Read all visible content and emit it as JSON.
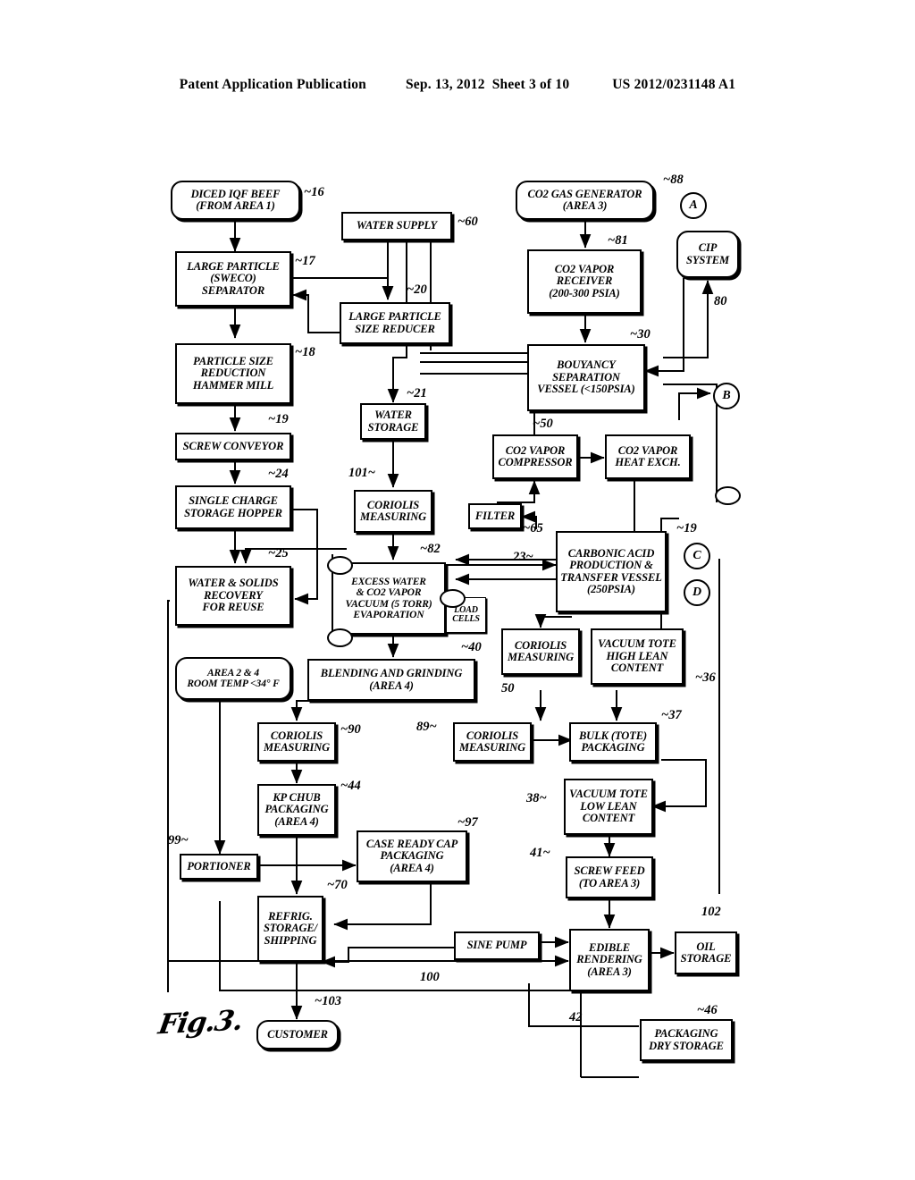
{
  "header": {
    "publication": "Patent Application Publication",
    "date": "Sep. 13, 2012",
    "sheet": "Sheet 3 of 10",
    "docnum": "US 2012/0231148 A1"
  },
  "figure": {
    "label": "Fig.3.",
    "nodes": [
      {
        "id": "n16",
        "ref": "16",
        "lines": [
          "DICED IQF BEEF",
          "(FROM AREA 1)"
        ]
      },
      {
        "id": "n17",
        "ref": "17",
        "lines": [
          "LARGE PARTICLE",
          "(SWECO)",
          "SEPARATOR"
        ]
      },
      {
        "id": "n18",
        "ref": "18",
        "lines": [
          "PARTICLE SIZE",
          "REDUCTION",
          "HAMMER MILL"
        ]
      },
      {
        "id": "n19",
        "ref": "19",
        "lines": [
          "SCREW CONVEYOR"
        ]
      },
      {
        "id": "n24",
        "ref": "24",
        "lines": [
          "SINGLE CHARGE",
          "STORAGE HOPPER"
        ]
      },
      {
        "id": "n25",
        "ref": "25",
        "lines": [
          "WATER & SOLIDS",
          "RECOVERY",
          "FOR REUSE"
        ]
      },
      {
        "id": "narea",
        "ref": "",
        "lines": [
          "AREA 2 & 4",
          "ROOM TEMP <34° F"
        ]
      },
      {
        "id": "n60",
        "ref": "60",
        "lines": [
          "WATER SUPPLY"
        ]
      },
      {
        "id": "n20",
        "ref": "20",
        "lines": [
          "LARGE PARTICLE",
          "SIZE REDUCER"
        ]
      },
      {
        "id": "n21",
        "ref": "21",
        "lines": [
          "WATER",
          "STORAGE"
        ]
      },
      {
        "id": "n101",
        "ref": "101",
        "lines": [
          "CORIOLIS",
          "MEASURING"
        ]
      },
      {
        "id": "n82",
        "ref": "82",
        "lines": [
          "EXCESS WATER",
          "& CO2 VAPOR",
          "VACUUM (5 TORR)",
          "EVAPORATION"
        ]
      },
      {
        "id": "nlc",
        "ref": "",
        "lines": [
          "LOAD",
          "CELLS"
        ]
      },
      {
        "id": "n40",
        "ref": "40",
        "lines": [
          "BLENDING AND GRINDING",
          "(AREA 4)"
        ]
      },
      {
        "id": "n90",
        "ref": "90",
        "lines": [
          "CORIOLIS",
          "MEASURING"
        ]
      },
      {
        "id": "n44",
        "ref": "44",
        "lines": [
          "KP CHUB",
          "PACKAGING",
          "(AREA 4)"
        ]
      },
      {
        "id": "n99",
        "ref": "99",
        "lines": [
          "PORTIONER"
        ]
      },
      {
        "id": "n70",
        "ref": "70",
        "lines": [
          "REFRIG.",
          "STORAGE/",
          "SHIPPING"
        ]
      },
      {
        "id": "n103",
        "ref": "103",
        "lines": [
          "CUSTOMER"
        ]
      },
      {
        "id": "n97",
        "ref": "97",
        "lines": [
          "CASE READY CAP",
          "PACKAGING",
          "(AREA 4)"
        ]
      },
      {
        "id": "n100",
        "ref": "100",
        "lines": [
          "SINE PUMP"
        ]
      },
      {
        "id": "n88",
        "ref": "88",
        "lines": [
          "CO2 GAS GENERATOR",
          "(AREA 3)"
        ]
      },
      {
        "id": "n81",
        "ref": "81",
        "lines": [
          "CO2 VAPOR",
          "RECEIVER",
          "(200-300 PSIA)"
        ]
      },
      {
        "id": "n80",
        "ref": "80",
        "lines": [
          "CIP",
          "SYSTEM"
        ]
      },
      {
        "id": "n30",
        "ref": "30",
        "lines": [
          "BOUYANCY",
          "SEPARATION",
          "VESSEL (<150PSIA)"
        ]
      },
      {
        "id": "n50c",
        "ref": "50",
        "lines": [
          "CO2 VAPOR",
          "COMPRESSOR"
        ]
      },
      {
        "id": "nhx",
        "ref": "",
        "lines": [
          "CO2 VAPOR",
          "HEAT EXCH."
        ]
      },
      {
        "id": "n65",
        "ref": "65",
        "lines": [
          "FILTER"
        ]
      },
      {
        "id": "n23",
        "ref": "19",
        "lines": [
          "CARBONIC ACID",
          "PRODUCTION &",
          "TRANSFER VESSEL",
          "(250PSIA)"
        ]
      },
      {
        "id": "n50m",
        "ref": "50",
        "lines": [
          "CORIOLIS",
          "MEASURING"
        ]
      },
      {
        "id": "n36",
        "ref": "36",
        "lines": [
          "VACUUM TOTE",
          "HIGH LEAN",
          "CONTENT"
        ]
      },
      {
        "id": "n89",
        "ref": "89",
        "lines": [
          "CORIOLIS",
          "MEASURING"
        ]
      },
      {
        "id": "n37",
        "ref": "37",
        "lines": [
          "BULK (TOTE)",
          "PACKAGING"
        ]
      },
      {
        "id": "n38",
        "ref": "38",
        "lines": [
          "VACUUM TOTE",
          "LOW LEAN",
          "CONTENT"
        ]
      },
      {
        "id": "n41",
        "ref": "41",
        "lines": [
          "SCREW FEED",
          "(TO AREA 3)"
        ]
      },
      {
        "id": "n42",
        "ref": "42",
        "lines": [
          "EDIBLE",
          "RENDERING",
          "(AREA 3)"
        ]
      },
      {
        "id": "n102",
        "ref": "102",
        "lines": [
          "OIL",
          "STORAGE"
        ]
      },
      {
        "id": "n46",
        "ref": "46",
        "lines": [
          "PACKAGING",
          "DRY STORAGE"
        ]
      }
    ],
    "extra_refs": [
      "23",
      "65",
      "19"
    ],
    "connector_tags": [
      "A",
      "B",
      "C",
      "D"
    ]
  }
}
